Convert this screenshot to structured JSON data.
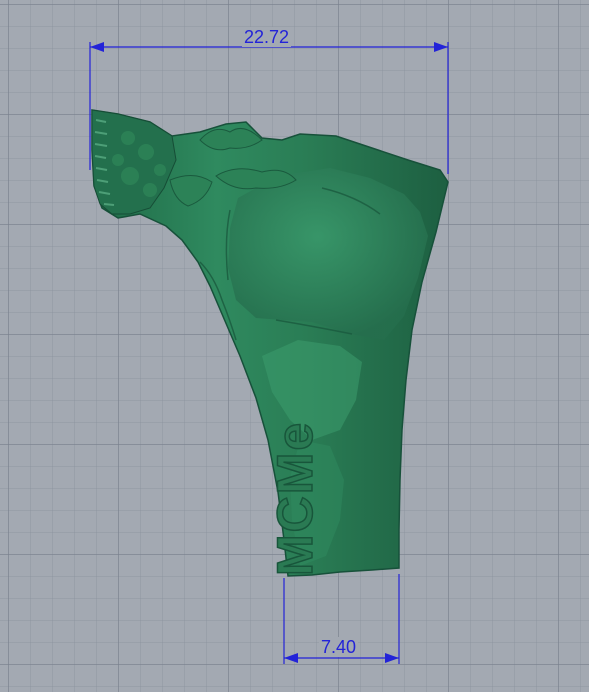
{
  "viewport": {
    "background_color": "#a3a9b2",
    "grid_color": "#7e8793"
  },
  "model": {
    "color": "#2b7a56",
    "embossed_text": "MCMe"
  },
  "dimensions": {
    "color": "#2323d8",
    "top_width": "22.72",
    "bottom_width": "7.40"
  }
}
